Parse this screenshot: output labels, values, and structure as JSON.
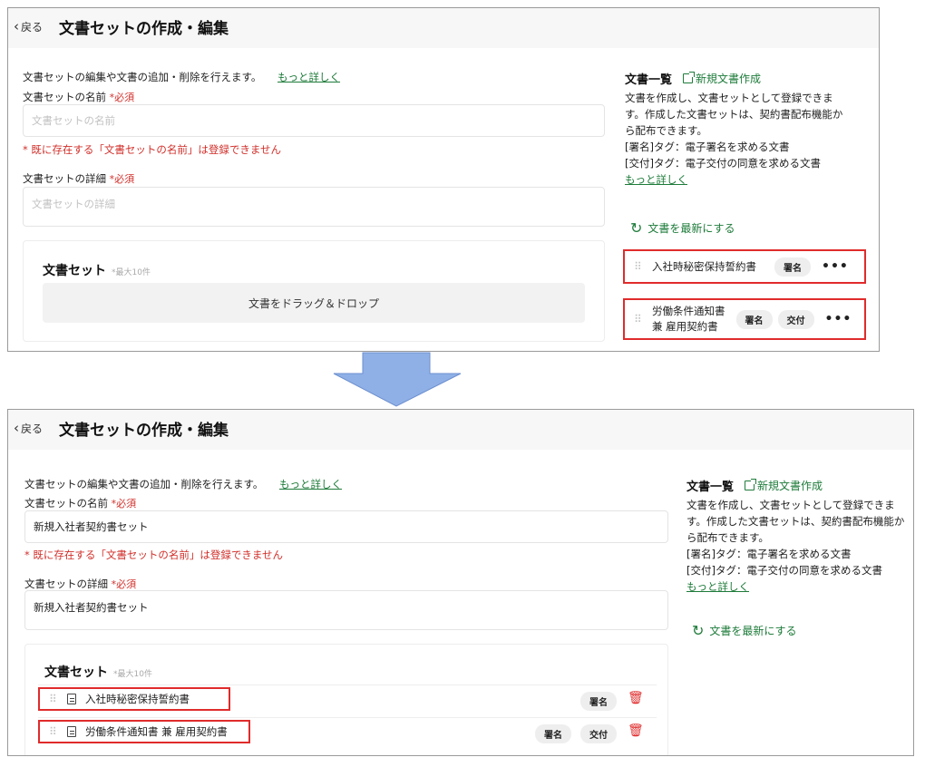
{
  "header": {
    "back_label": "戻る",
    "title": "文書セットの作成・編集"
  },
  "form": {
    "intro": "文書セットの編集や文書の追加・削除を行えます。",
    "more_link": "もっと詳しく",
    "name_label": "文書セットの名前",
    "required_mark": "*必須",
    "name_placeholder": "文書セットの名前",
    "name_error": "* 既に存在する「文書セットの名前」は登録できません",
    "detail_label": "文書セットの詳細",
    "detail_placeholder": "文書セットの詳細"
  },
  "docset": {
    "title": "文書セット",
    "max_note": "*最大10件",
    "dropzone_label": "文書をドラッグ＆ドロップ"
  },
  "sidebar": {
    "heading": "文書一覧",
    "new_doc_label": "新規文書作成",
    "desc_lines": [
      "文書を作成し、文書セットとして登録できま",
      "す。作成した文書セットは、契約書配布機能か",
      "ら配布できます。",
      "[署名]タグ：電子署名を求める文書",
      "[交付]タグ：電子交付の同意を求める文書"
    ],
    "more_link": "もっと詳しく",
    "refresh_label": "文書を最新にする"
  },
  "documents": [
    {
      "name": "入社時秘密保持誓約書",
      "name_line1": "入社時秘密保持誓約書",
      "name_line2": "",
      "tags": [
        "署名"
      ]
    },
    {
      "name": "労働条件通知書 兼 雇用契約書",
      "name_line1": "労働条件通知書",
      "name_line2": "兼 雇用契約書",
      "tags": [
        "署名",
        "交付"
      ]
    }
  ],
  "after": {
    "name_value": "新規入社者契約書セット",
    "detail_value": "新規入社者契約書セット"
  },
  "colors": {
    "accent_green": "#1e7b3a",
    "required_red": "#d0302b",
    "highlight_red": "#e02b2b",
    "arrow_blue": "#8fb0e6"
  },
  "icons": {
    "back": "chevron-left-icon",
    "external": "external-link-icon",
    "refresh": "refresh-icon",
    "drag": "drag-handle-icon",
    "more": "more-horizontal-icon",
    "document": "document-icon",
    "delete": "trash-icon"
  }
}
